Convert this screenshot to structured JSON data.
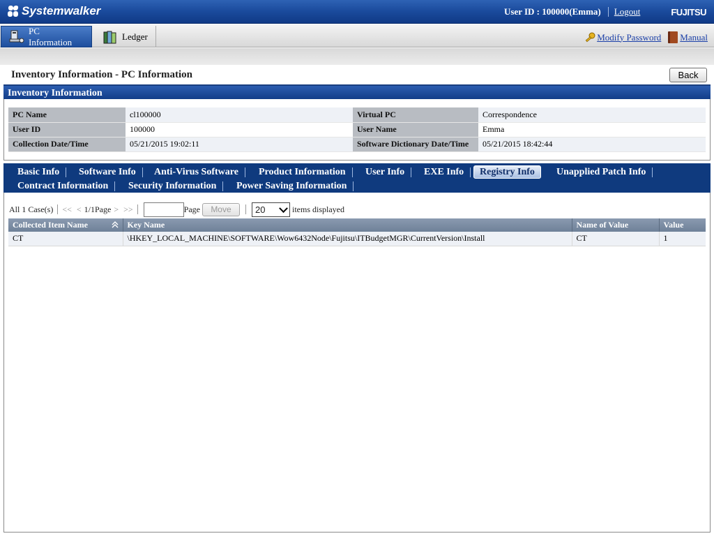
{
  "header": {
    "brand": "Systemwalker",
    "user_label": "User ID : 100000(Emma)",
    "logout": "Logout",
    "vendor": "FUJITSU"
  },
  "nav": {
    "tabs": [
      {
        "label": "PC Information",
        "active": true
      },
      {
        "label": "Ledger",
        "active": false
      }
    ],
    "modify_password": "Modify Password",
    "manual": "Manual"
  },
  "page": {
    "title": "Inventory Information - PC Information",
    "back": "Back"
  },
  "inventory": {
    "section_title": "Inventory Information",
    "rows": [
      {
        "label1": "PC Name",
        "value1": "cl100000",
        "label2": "Virtual PC",
        "value2": "Correspondence"
      },
      {
        "label1": "User ID",
        "value1": "100000",
        "label2": "User Name",
        "value2": "Emma"
      },
      {
        "label1": "Collection Date/Time",
        "value1": "05/21/2015 19:02:11",
        "label2": "Software Dictionary Date/Time",
        "value2": "05/21/2015 18:42:44"
      }
    ]
  },
  "tabs": [
    {
      "label": "Basic Info",
      "active": false
    },
    {
      "label": "Software Info",
      "active": false
    },
    {
      "label": "Anti-Virus Software",
      "active": false
    },
    {
      "label": "Product Information",
      "active": false
    },
    {
      "label": "User Info",
      "active": false
    },
    {
      "label": "EXE Info",
      "active": false
    },
    {
      "label": "Registry Info",
      "active": true
    },
    {
      "label": "Unapplied Patch Info",
      "active": false
    },
    {
      "label": "Contract Information",
      "active": false
    },
    {
      "label": "Security Information",
      "active": false
    },
    {
      "label": "Power Saving Information",
      "active": false
    }
  ],
  "pager": {
    "count": "All 1 Case(s)",
    "first": "<<",
    "prev": "<",
    "position": "1/1Page",
    "next": ">",
    "last": ">>",
    "page_input": "",
    "page_label": "Page",
    "move": "Move",
    "per_page": "20",
    "per_page_label": "items displayed"
  },
  "registry": {
    "columns": [
      "Collected Item Name",
      "Key Name",
      "Name of Value",
      "Value"
    ],
    "rows": [
      [
        "CT",
        "\\HKEY_LOCAL_MACHINE\\SOFTWARE\\Wow6432Node\\Fujitsu\\ITBudgetMGR\\CurrentVersion\\Install",
        "CT",
        "1"
      ]
    ]
  },
  "colors": {
    "header_blue": "#1a4a9c",
    "section_blue": "#123d88",
    "tab_area": "#0f3a7e",
    "label_gray": "#b8bcc2",
    "grid_header": "#7a8ba2",
    "link_blue": "#1a3fa8"
  }
}
